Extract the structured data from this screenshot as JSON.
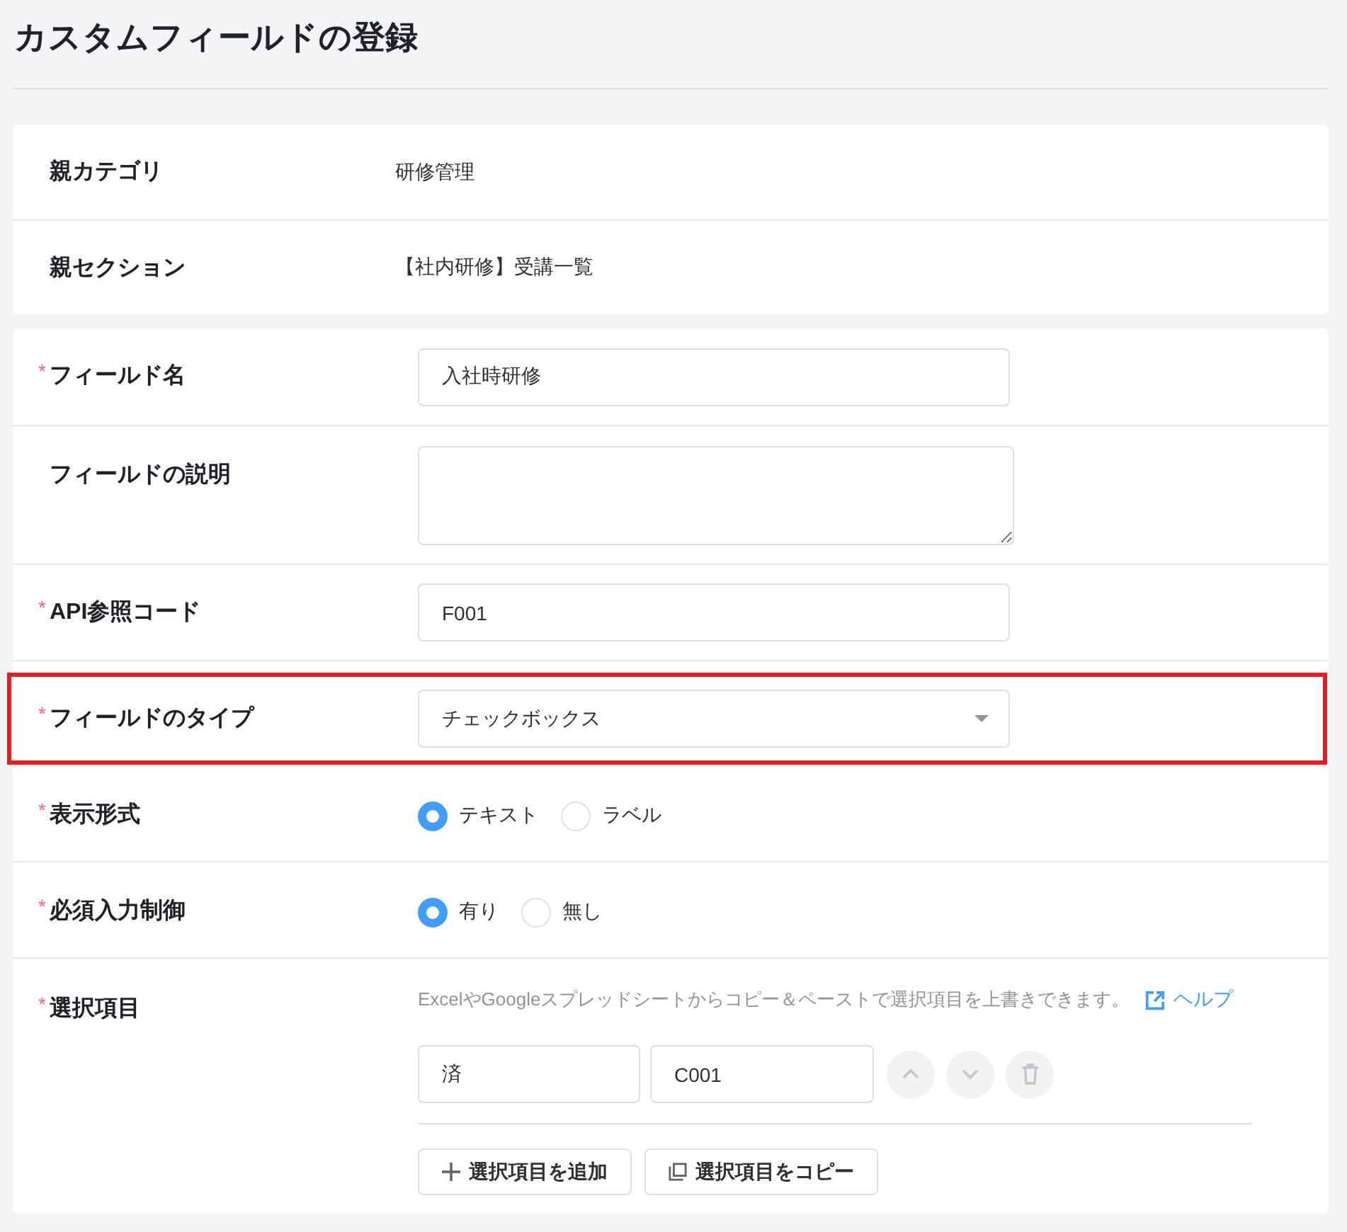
{
  "page": {
    "title": "カスタムフィールドの登録"
  },
  "parent_info": [
    {
      "label": "親カテゴリ",
      "value": "研修管理"
    },
    {
      "label": "親セクション",
      "value": "【社内研修】受講一覧"
    }
  ],
  "fields": [
    {
      "kind": "text",
      "required_mark": "*",
      "label": "フィールド名",
      "value": "入社時研修"
    },
    {
      "kind": "textarea",
      "label": "フィールドの説明"
    },
    {
      "kind": "text",
      "required_mark": "*",
      "label": "API参照コード",
      "value": "F001"
    },
    {
      "kind": "select",
      "required_mark": "*",
      "label": "フィールドのタイプ",
      "value": "チェックボックス",
      "highlighted": true
    },
    {
      "kind": "radio",
      "required_mark": "*",
      "label": "表示形式",
      "options": [
        {
          "label": "テキスト",
          "selected": true
        },
        {
          "label": "ラベル",
          "selected": false
        }
      ]
    },
    {
      "kind": "radio",
      "required_mark": "*",
      "label": "必須入力制御",
      "options": [
        {
          "label": "有り",
          "selected": true
        },
        {
          "label": "無し",
          "selected": false
        }
      ]
    },
    {
      "kind": "choices",
      "required_mark": "*",
      "label": "選択項目",
      "hint": "ExcelやGoogleスプレッドシートからコピー＆ペーストで選択項目を上書きできます。",
      "help_link": "ヘルプ",
      "items": [
        {
          "name": "済",
          "code": "C001"
        }
      ],
      "buttons": [
        {
          "kind": "add",
          "label": "選択項目を追加"
        },
        {
          "kind": "copy",
          "label": "選択項目をコピー"
        }
      ]
    }
  ]
}
